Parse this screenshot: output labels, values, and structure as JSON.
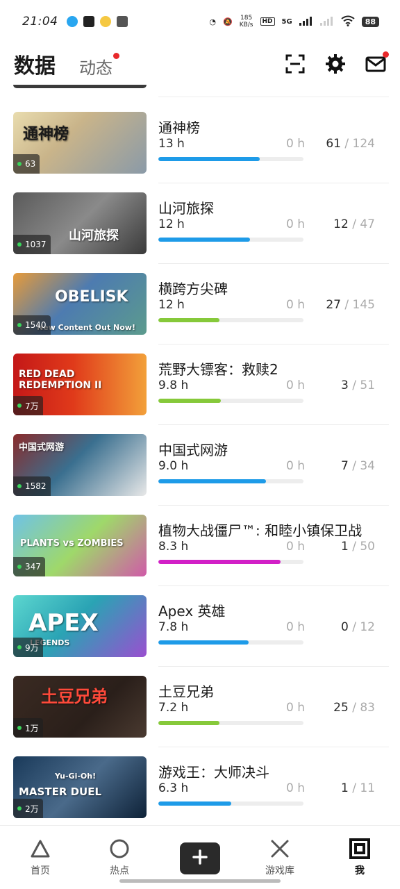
{
  "status_bar": {
    "time": "21:04",
    "net_speed_value": "185",
    "net_speed_unit": "KB/s",
    "hd_label": "HD",
    "network": "5G",
    "battery": "88"
  },
  "header": {
    "tab_active": "数据",
    "tab_other": "动态",
    "icons": [
      "scan-icon",
      "gear-icon",
      "mail-icon"
    ]
  },
  "games": [
    {
      "name": "通神榜",
      "hours": "13 h",
      "recent": "0 h",
      "ach_done": "61",
      "ach_sep": "/",
      "ach_total": "124",
      "badge": "63",
      "progress": 0.7,
      "bar_color": "#1e9be8",
      "thumb_text": "通神榜"
    },
    {
      "name": "山河旅探",
      "hours": "12 h",
      "recent": "0 h",
      "ach_done": "12",
      "ach_sep": "/",
      "ach_total": "47",
      "badge": "1037",
      "progress": 0.63,
      "bar_color": "#1e9be8",
      "thumb_text": "山河旅探"
    },
    {
      "name": "横跨方尖碑",
      "hours": "12 h",
      "recent": "0 h",
      "ach_done": "27",
      "ach_sep": "/",
      "ach_total": "145",
      "badge": "1540",
      "progress": 0.42,
      "bar_color": "#86c93a",
      "thumb_text": "OBELISK",
      "thumb_subtext": "New Content Out Now!"
    },
    {
      "name": "荒野大镖客：救赎2",
      "hours": "9.8 h",
      "recent": "0 h",
      "ach_done": "3",
      "ach_sep": "/",
      "ach_total": "51",
      "badge": "7万",
      "progress": 0.43,
      "bar_color": "#86c93a",
      "thumb_text": "RED DEAD REDEMPTION II"
    },
    {
      "name": "中国式网游",
      "hours": "9.0 h",
      "recent": "0 h",
      "ach_done": "7",
      "ach_sep": "/",
      "ach_total": "34",
      "badge": "1582",
      "progress": 0.74,
      "bar_color": "#1e9be8",
      "thumb_text": "中国式网游"
    },
    {
      "name": "植物大战僵尸™: 和睦小镇保卫战",
      "hours": "8.3 h",
      "recent": "0 h",
      "ach_done": "1",
      "ach_sep": "/",
      "ach_total": "50",
      "badge": "347",
      "progress": 0.84,
      "bar_color": "#d21fc7",
      "thumb_text": "PLANTS vs ZOMBIES"
    },
    {
      "name": "Apex 英雄",
      "hours": "7.8 h",
      "recent": "0 h",
      "ach_done": "0",
      "ach_sep": "/",
      "ach_total": "12",
      "badge": "9万",
      "progress": 0.62,
      "bar_color": "#1e9be8",
      "thumb_text": "APEX",
      "thumb_subtext": "LEGENDS"
    },
    {
      "name": "土豆兄弟",
      "hours": "7.2 h",
      "recent": "0 h",
      "ach_done": "25",
      "ach_sep": "/",
      "ach_total": "83",
      "badge": "1万",
      "progress": 0.42,
      "bar_color": "#86c93a",
      "thumb_text": "土豆兄弟"
    },
    {
      "name": "游戏王：大师决斗",
      "hours": "6.3 h",
      "recent": "0 h",
      "ach_done": "1",
      "ach_sep": "/",
      "ach_total": "11",
      "badge": "2万",
      "progress": 0.5,
      "bar_color": "#1e9be8",
      "thumb_text": "MASTER DUEL",
      "thumb_subtext": "Yu-Gi-Oh!"
    }
  ],
  "bottom_nav": {
    "home": "首页",
    "hot": "热点",
    "library": "游戏库",
    "me": "我"
  }
}
